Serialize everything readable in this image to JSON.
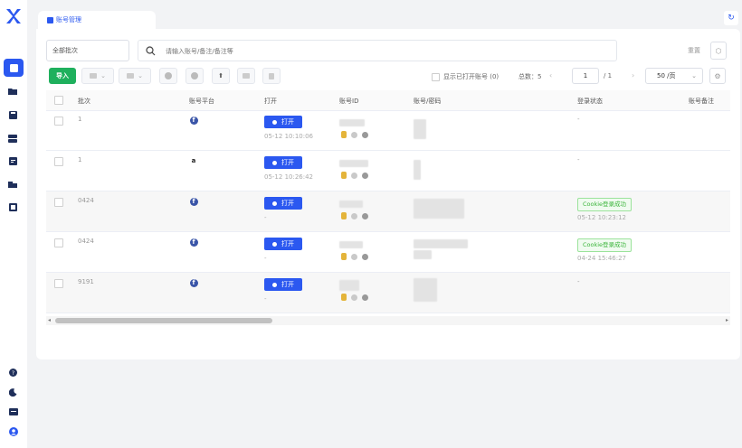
{
  "colors": {
    "accent": "#2b58f0",
    "success": "#1fb05d",
    "cookie_tag": "#3bb53b"
  },
  "tabs": [
    {
      "label": "账号管理"
    }
  ],
  "filters": {
    "batch_select": "全部批次",
    "search_placeholder": "请输入账号/备注/备注等",
    "reset_label": "重置"
  },
  "toolbar": {
    "import_label": "导入",
    "show_opened_label": "显示已打开账号 (0)",
    "total_label": "总数：5",
    "page_current": "1",
    "page_of": "/ 1",
    "page_size": "50 /页"
  },
  "table": {
    "columns": [
      "批次",
      "账号平台",
      "打开",
      "账号ID",
      "账号/密码",
      "登录状态",
      "账号备注"
    ],
    "open_label": "打开",
    "rows": [
      {
        "batch": "1",
        "platform": "facebook-icon",
        "open_time": "05-12 10:10:06",
        "login_status": "-",
        "login_time": ""
      },
      {
        "batch": "1",
        "platform": "amazon-icon",
        "open_time": "05-12 10:26:42",
        "login_status": "-",
        "login_time": ""
      },
      {
        "batch": "0424",
        "platform": "facebook-icon",
        "open_time": "-",
        "login_status": "Cookie登录成功",
        "login_time": "05-12 10:23:12"
      },
      {
        "batch": "0424",
        "platform": "facebook-icon",
        "open_time": "-",
        "login_status": "Cookie登录成功",
        "login_time": "04-24 15:46:27"
      },
      {
        "batch": "9191",
        "platform": "facebook-icon",
        "open_time": "-",
        "login_status": "-",
        "login_time": ""
      }
    ]
  }
}
